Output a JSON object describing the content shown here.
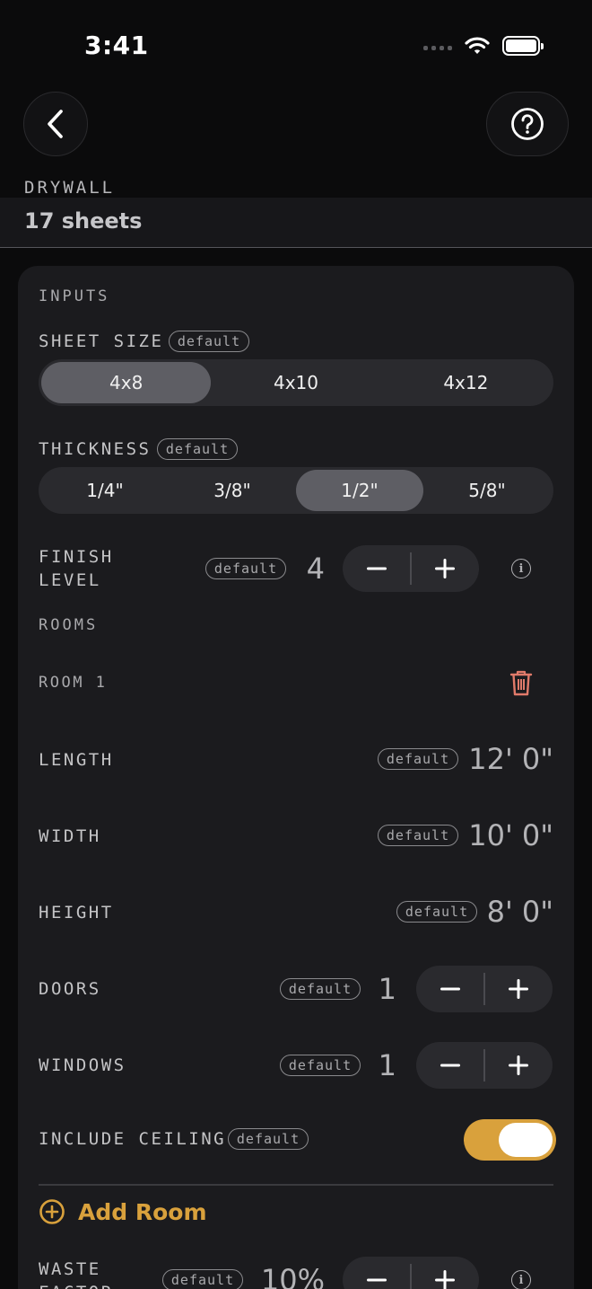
{
  "status": {
    "time": "3:41"
  },
  "header": {
    "app_label": "DRYWALL",
    "result": "17 sheets"
  },
  "icons": {
    "back": "chevron-left-icon",
    "help": "question-circle-icon",
    "delete": "trash-icon",
    "add": "plus-circle-icon",
    "info": "info-icon",
    "minus": "minus-icon",
    "plus": "plus-icon"
  },
  "colors": {
    "accent": "#d9a13c",
    "danger": "#e07a6a",
    "background": "#0b0b0c",
    "card": "#1b1b1e"
  },
  "inputs": {
    "section_label": "INPUTS",
    "sheet_size": {
      "label": "SHEET SIZE",
      "badge": "default",
      "options": [
        "4x8",
        "4x10",
        "4x12"
      ],
      "selected": "4x8"
    },
    "thickness": {
      "label": "THICKNESS",
      "badge": "default",
      "options": [
        "1/4\"",
        "3/8\"",
        "1/2\"",
        "5/8\""
      ],
      "selected": "1/2\""
    },
    "finish_level": {
      "label_line1": "FINISH",
      "label_line2": "LEVEL",
      "badge": "default",
      "value": "4",
      "info": "i"
    }
  },
  "rooms": {
    "section_label": "ROOMS",
    "room1": {
      "title": "ROOM 1",
      "length": {
        "label": "LENGTH",
        "badge": "default",
        "value": "12' 0\""
      },
      "width": {
        "label": "WIDTH",
        "badge": "default",
        "value": "10' 0\""
      },
      "height": {
        "label": "HEIGHT",
        "badge": "default",
        "value": "8' 0\""
      },
      "doors": {
        "label": "DOORS",
        "badge": "default",
        "value": "1"
      },
      "windows": {
        "label": "WINDOWS",
        "badge": "default",
        "value": "1"
      },
      "include_ceiling": {
        "label": "INCLUDE CEILING",
        "badge": "default",
        "on": true
      }
    },
    "add_room_label": "Add Room"
  },
  "waste_factor": {
    "label_line1": "WASTE",
    "label_line2": "FACTOR",
    "badge": "default",
    "value": "10%",
    "info": "i"
  }
}
